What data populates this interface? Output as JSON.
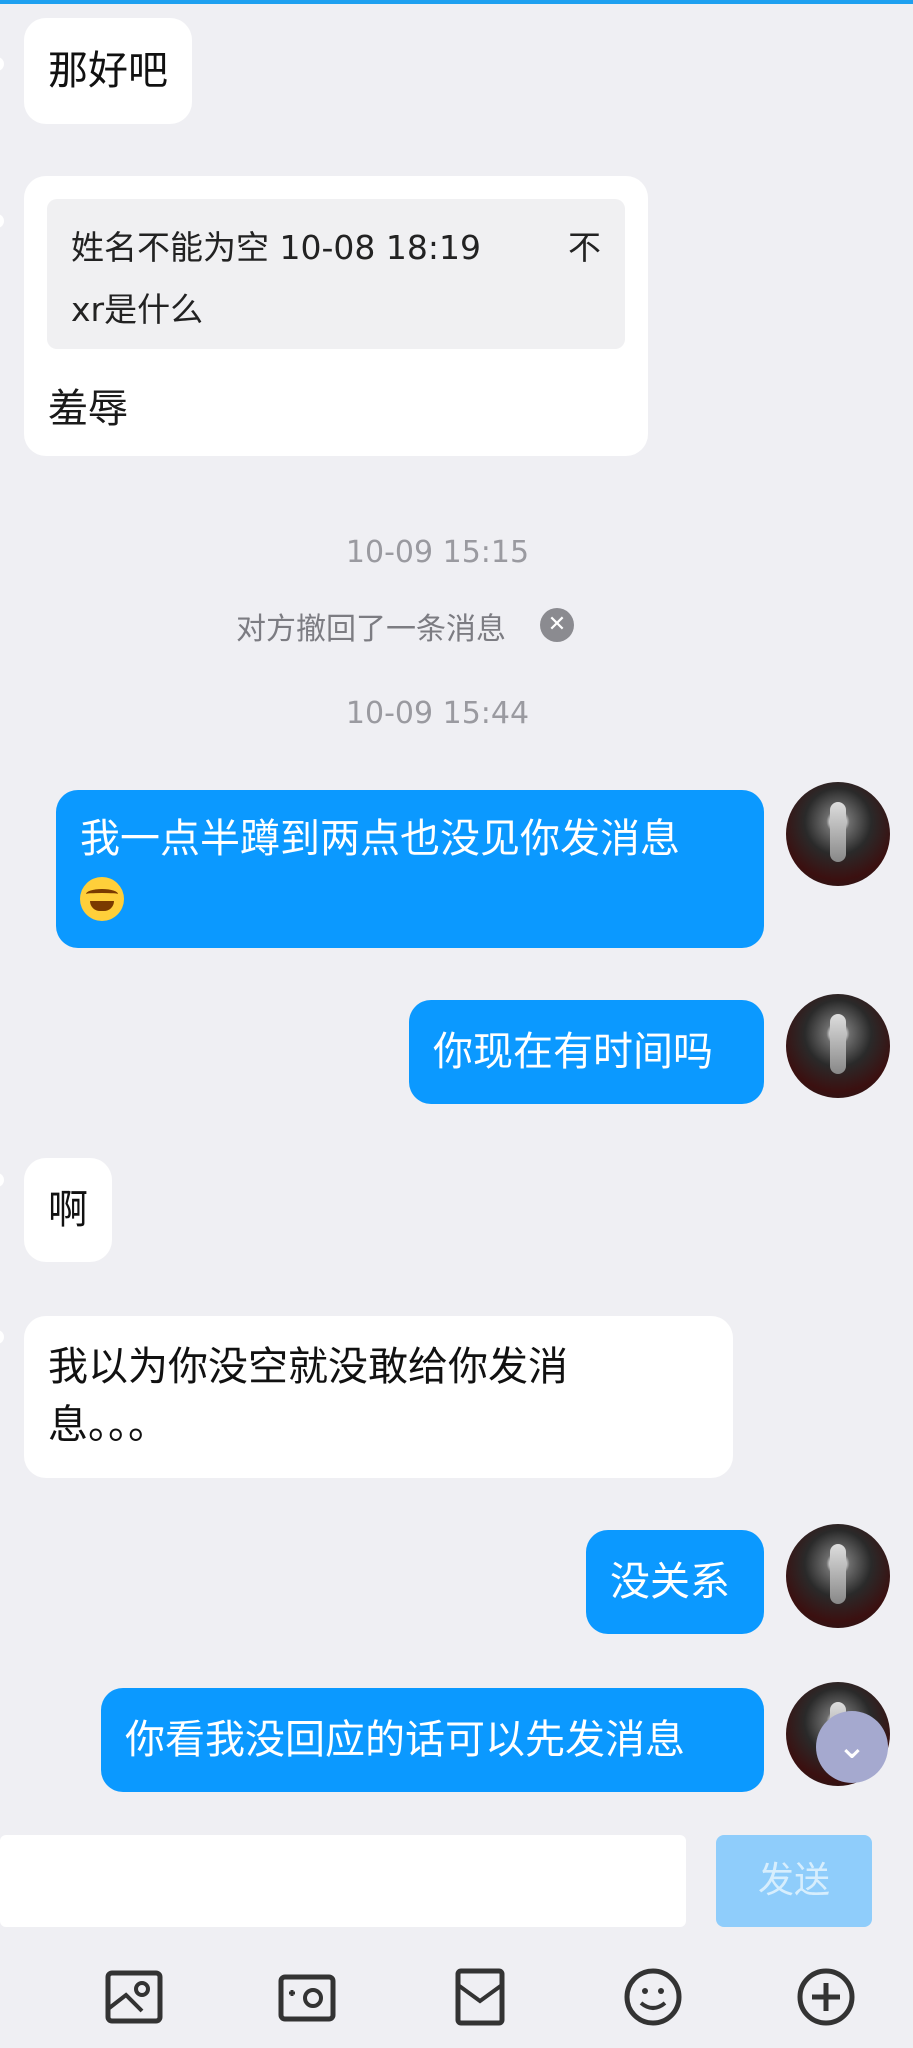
{
  "messages": {
    "m1": "那好吧",
    "quote_header": "姓名不能为空 10-08 18:19",
    "quote_flag": "不",
    "quote_text": "xr是什么",
    "m2": "羞辱",
    "time1": "10-09 15:15",
    "recall": "对方撤回了一条消息",
    "time2": "10-09 15:44",
    "out1": "我一点半蹲到两点也没见你发消息",
    "out2": "你现在有时间吗",
    "in3": "啊",
    "in4_line1": "我以为你没空就没敢给你发消",
    "in4_line2": "息。。。",
    "out3": "没关系",
    "out4": "你看我没回应的话可以先发消息"
  },
  "input": {
    "placeholder": "",
    "send_label": "发送"
  },
  "icons": [
    "image-icon",
    "camera-icon",
    "file-icon",
    "emoji-icon",
    "plus-icon"
  ],
  "colors": {
    "accent": "#0b99ff",
    "background": "#efeff3"
  }
}
